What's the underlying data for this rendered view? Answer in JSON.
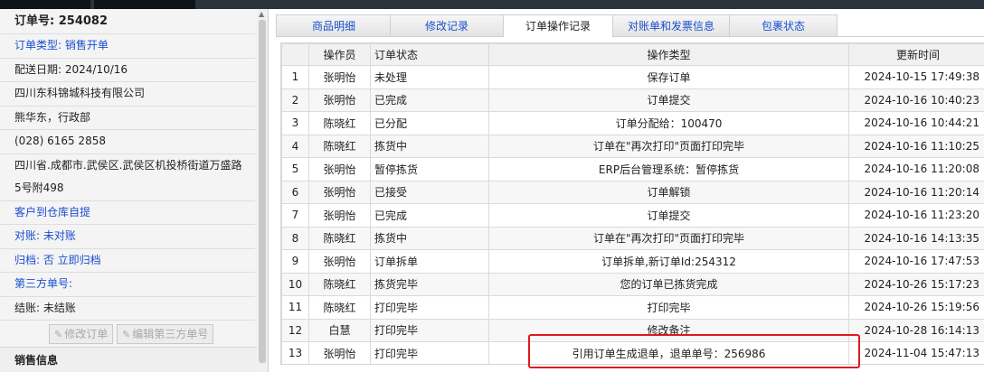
{
  "left_panel": {
    "order_no": "订单号: 254082",
    "order_type": "订单类型: 销售开单",
    "delivery_date": "配送日期: 2024/10/16",
    "company": "四川东科锦城科技有限公司",
    "contact": "熊华东，行政部",
    "phone": "(028) 6165 2858",
    "address_line1": "四川省.成都市.武侯区.武侯区机投桥街道万盛路",
    "address_line2": "5号附498",
    "pickup": "客户到仓库自提",
    "reconcile": "对账: 未对账",
    "archive": "归档:  否 立即归档",
    "third_party": "第三方单号:",
    "settle": "结账: 未结账",
    "btn_modify": "修改订单",
    "btn_edit_third": "编辑第三方单号",
    "section_sales": "销售信息"
  },
  "tabs": [
    {
      "label": "商品明细"
    },
    {
      "label": "修改记录"
    },
    {
      "label": "订单操作记录"
    },
    {
      "label": "对账单和发票信息"
    },
    {
      "label": "包裹状态"
    }
  ],
  "table": {
    "headers": [
      "",
      "操作员",
      "订单状态",
      "操作类型",
      "更新时间"
    ],
    "rows": [
      [
        "1",
        "张明怡",
        "未处理",
        "保存订单",
        "2024-10-15 17:49:38"
      ],
      [
        "2",
        "张明怡",
        "已完成",
        "订单提交",
        "2024-10-16 10:40:23"
      ],
      [
        "3",
        "陈晓红",
        "已分配",
        "订单分配给：100470",
        "2024-10-16 10:44:21"
      ],
      [
        "4",
        "陈晓红",
        "拣货中",
        "订单在\"再次打印\"页面打印完毕",
        "2024-10-16 11:10:25"
      ],
      [
        "5",
        "张明怡",
        "暂停拣货",
        "ERP后台管理系统：暂停拣货",
        "2024-10-16 11:20:08"
      ],
      [
        "6",
        "张明怡",
        "已接受",
        "订单解锁",
        "2024-10-16 11:20:14"
      ],
      [
        "7",
        "张明怡",
        "已完成",
        "订单提交",
        "2024-10-16 11:23:20"
      ],
      [
        "8",
        "陈晓红",
        "拣货中",
        "订单在\"再次打印\"页面打印完毕",
        "2024-10-16 14:13:35"
      ],
      [
        "9",
        "张明怡",
        "订单拆单",
        "订单拆单,新订单Id:254312",
        "2024-10-16 17:47:53"
      ],
      [
        "10",
        "陈晓红",
        "拣货完毕",
        "您的订单已拣货完成",
        "2024-10-26 15:17:23"
      ],
      [
        "11",
        "陈晓红",
        "打印完毕",
        "打印完毕",
        "2024-10-26 15:19:56"
      ],
      [
        "12",
        "白慧",
        "打印完毕",
        "修改备注",
        "2024-10-28 16:14:13"
      ],
      [
        "13",
        "张明怡",
        "打印完毕",
        "引用订单生成退单，退单单号：256986",
        "2024-11-04 15:47:13"
      ]
    ]
  },
  "colors": {
    "accent_blue": "#1a4ecf",
    "highlight_red": "#e0191f"
  }
}
